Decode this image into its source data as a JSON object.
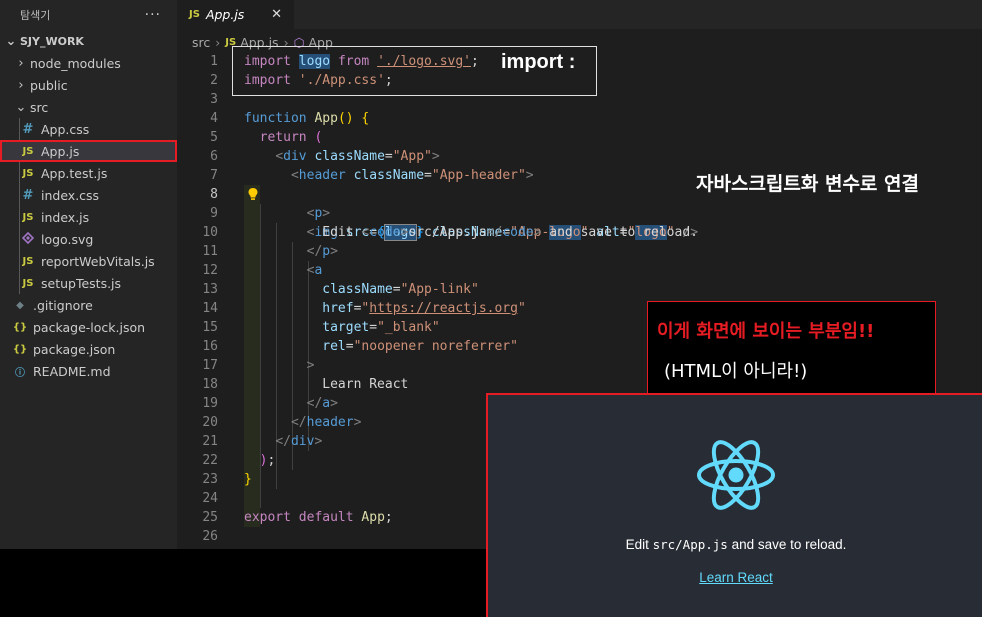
{
  "sidebar": {
    "title": "탐색기",
    "more": "···",
    "root": "SJY_WORK",
    "items": [
      {
        "label": "node_modules",
        "type": "folder",
        "state": "collapsed"
      },
      {
        "label": "public",
        "type": "folder",
        "state": "collapsed"
      },
      {
        "label": "src",
        "type": "folder",
        "state": "expanded"
      },
      {
        "label": "App.css",
        "type": "css",
        "icon": "#"
      },
      {
        "label": "App.js",
        "type": "js",
        "icon": "JS",
        "selected": true
      },
      {
        "label": "App.test.js",
        "type": "js",
        "icon": "JS"
      },
      {
        "label": "index.css",
        "type": "css",
        "icon": "#"
      },
      {
        "label": "index.js",
        "type": "js",
        "icon": "JS"
      },
      {
        "label": "logo.svg",
        "type": "svg",
        "icon": "svg-file-icon"
      },
      {
        "label": "reportWebVitals.js",
        "type": "js",
        "icon": "JS"
      },
      {
        "label": "setupTests.js",
        "type": "js",
        "icon": "JS"
      },
      {
        "label": ".gitignore",
        "type": "git",
        "icon": "◆"
      },
      {
        "label": "package-lock.json",
        "type": "json",
        "icon": "{}"
      },
      {
        "label": "package.json",
        "type": "json",
        "icon": "{}"
      },
      {
        "label": "README.md",
        "type": "md",
        "icon": "ⓘ"
      }
    ]
  },
  "tab": {
    "icon": "JS",
    "label": "App.js",
    "close": "✕"
  },
  "breadcrumb": {
    "folder": "src",
    "file": "App.js",
    "symbol": "App"
  },
  "code": {
    "active_line": 8,
    "line_numbers": [
      "1",
      "2",
      "3",
      "4",
      "5",
      "6",
      "7",
      "8",
      "9",
      "10",
      "11",
      "12",
      "13",
      "14",
      "15",
      "16",
      "17",
      "18",
      "19",
      "20",
      "21",
      "22",
      "23",
      "24",
      "25",
      "26"
    ]
  },
  "annotations": {
    "import_note": "import :",
    "var_note": "자바스크립트화 변수로 연결",
    "screen_note_1": "이게 화면에 보이는 부분임!!",
    "screen_note_2": "(HTML이 아니라!)"
  },
  "preview": {
    "text_before": "Edit ",
    "text_code": "src/App.js",
    "text_after": " and save to reload.",
    "link": "Learn React"
  },
  "colors": {
    "highlight_border": "#e51c23",
    "react_logo": "#61dafb",
    "preview_bg": "#282c34",
    "editor_bg": "#1e1e1e",
    "sidebar_bg": "#252526"
  }
}
